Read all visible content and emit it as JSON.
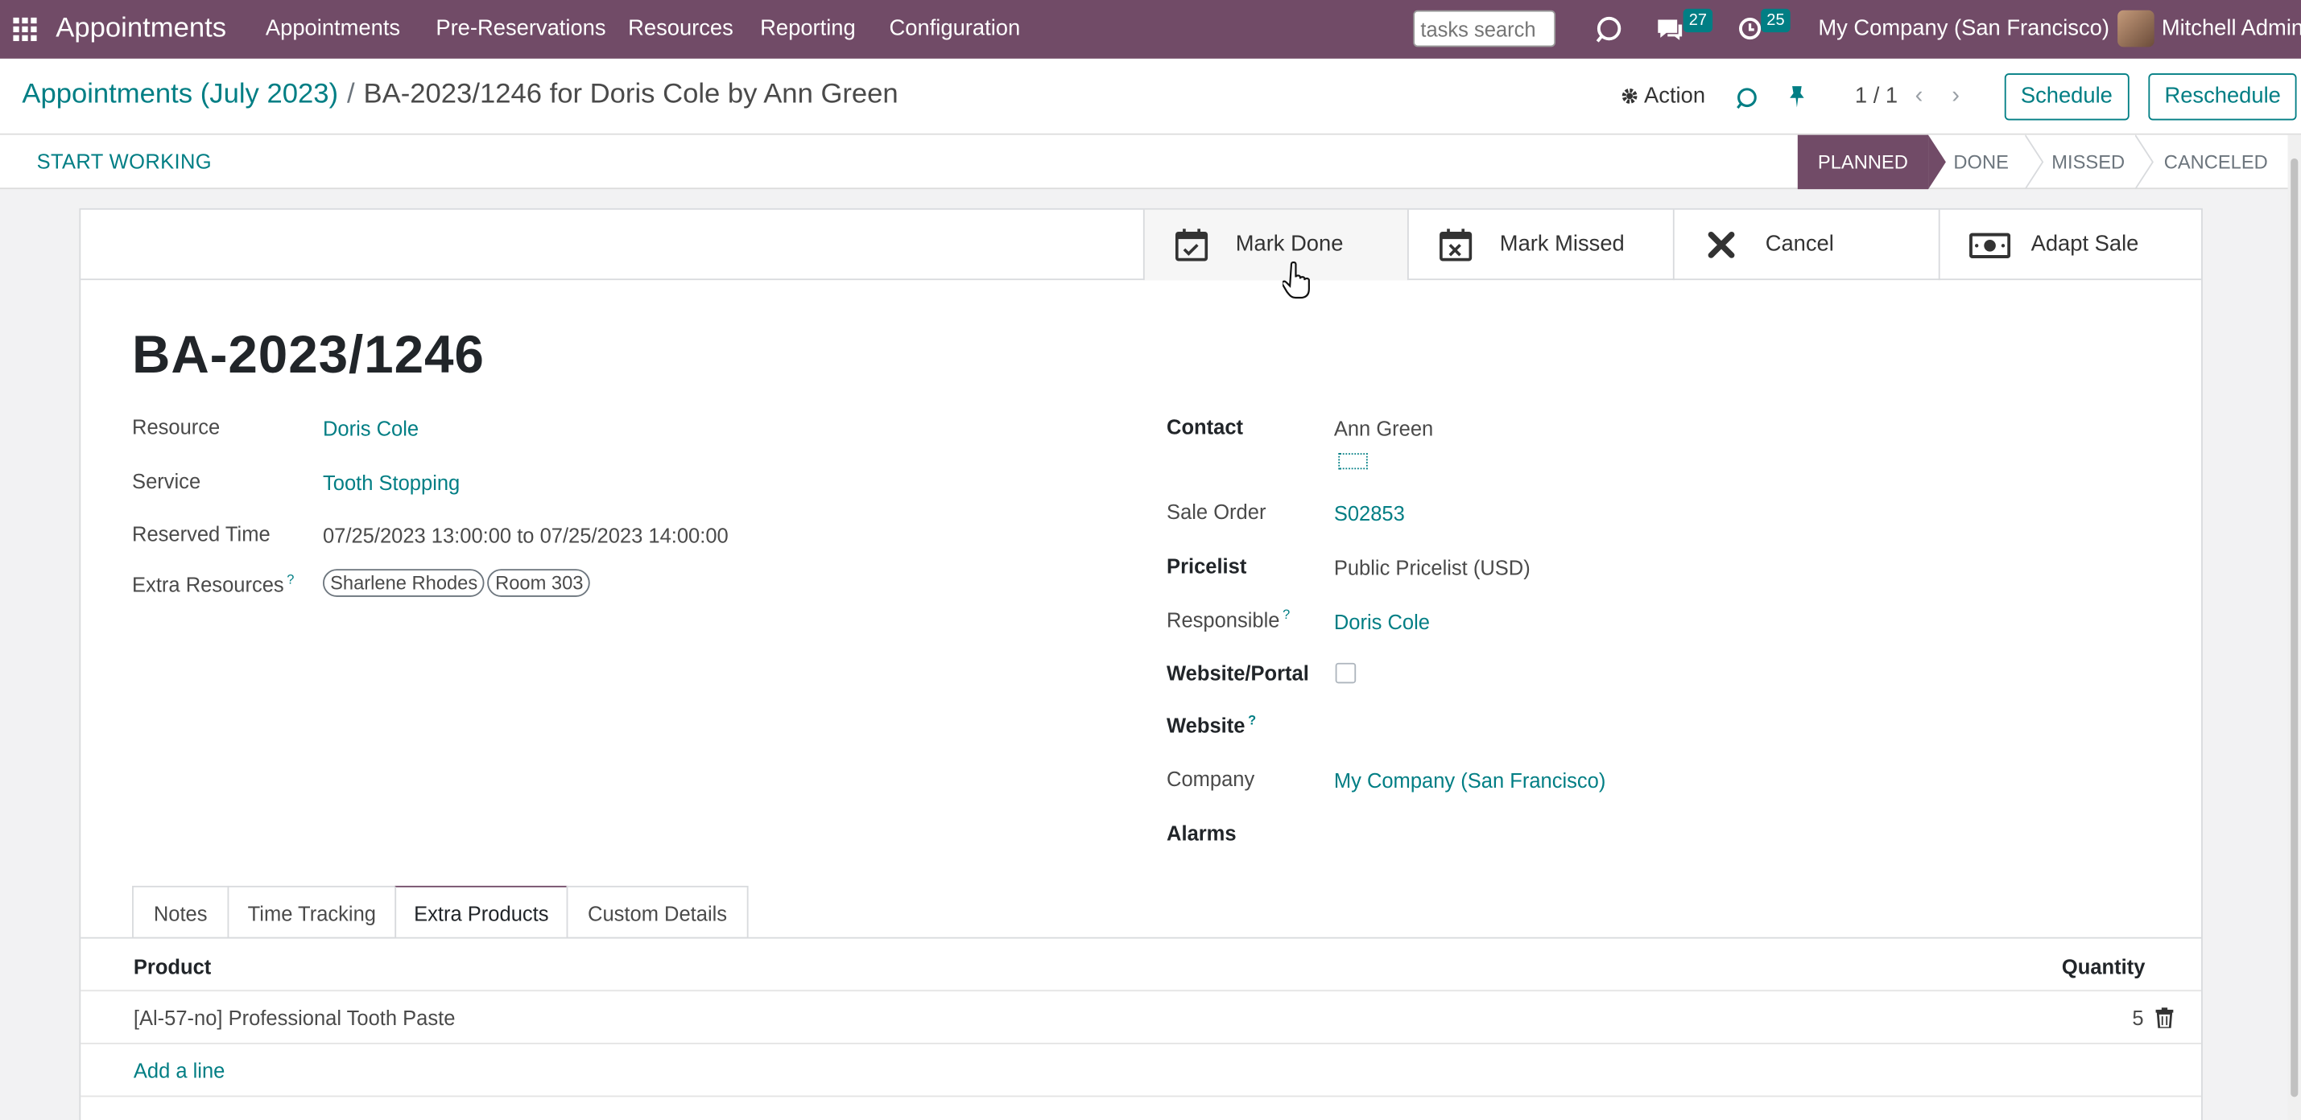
{
  "navbar": {
    "brand": "Appointments",
    "menus": [
      "Appointments",
      "Pre-Reservations",
      "Resources",
      "Reporting",
      "Configuration"
    ],
    "search_placeholder": "tasks search",
    "messages_count": "27",
    "activities_count": "25",
    "company": "My Company (San Francisco)",
    "user": "Mitchell Admin"
  },
  "breadcrumb": {
    "parent": "Appointments (July 2023)",
    "separator": "/",
    "current": "BA-2023/1246 for Doris Cole by Ann Green"
  },
  "control": {
    "action_label": "Action",
    "pager": "1 / 1",
    "schedule_label": "Schedule",
    "reschedule_label": "Reschedule"
  },
  "statusbar": {
    "start_working": "START WORKING",
    "stages": [
      "PLANNED",
      "DONE",
      "MISSED",
      "CANCELED"
    ],
    "active_stage": "PLANNED"
  },
  "smart_buttons": {
    "mark_done": "Mark Done",
    "mark_missed": "Mark Missed",
    "cancel": "Cancel",
    "adapt_sale": "Adapt Sale"
  },
  "record": {
    "title": "BA-2023/1246",
    "left": {
      "resource_label": "Resource",
      "resource": "Doris Cole",
      "service_label": "Service",
      "service": "Tooth Stopping",
      "reserved_time_label": "Reserved Time",
      "reserved_time": "07/25/2023 13:00:00 to 07/25/2023 14:00:00",
      "extra_resources_label": "Extra Resources",
      "extra_resources": [
        "Sharlene Rhodes",
        "Room 303"
      ]
    },
    "right": {
      "contact_label": "Contact",
      "contact": "Ann Green",
      "sale_order_label": "Sale Order",
      "sale_order": "S02853",
      "pricelist_label": "Pricelist",
      "pricelist": "Public Pricelist (USD)",
      "responsible_label": "Responsible",
      "responsible": "Doris Cole",
      "website_portal_label": "Website/Portal",
      "website_label": "Website",
      "company_label": "Company",
      "company": "My Company (San Francisco)",
      "alarms_label": "Alarms"
    },
    "help_mark": "?"
  },
  "tabs": [
    "Notes",
    "Time Tracking",
    "Extra Products",
    "Custom Details"
  ],
  "active_tab": "Extra Products",
  "products_table": {
    "headers": {
      "product": "Product",
      "quantity": "Quantity"
    },
    "rows": [
      {
        "product": "[Al-57-no] Professional Tooth Paste",
        "quantity": "5"
      }
    ],
    "add_line": "Add a line"
  },
  "colors": {
    "brand": "#714b67",
    "link": "#017e84"
  }
}
